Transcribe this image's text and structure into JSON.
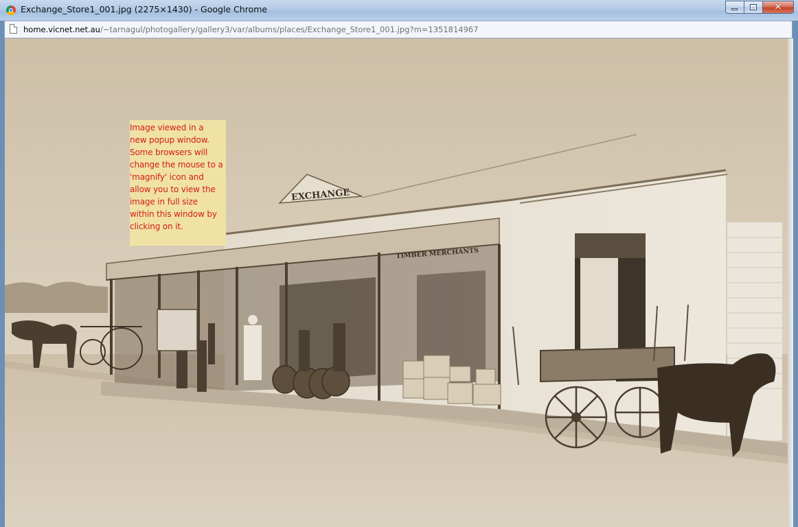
{
  "window": {
    "title": "Exchange_Store1_001.jpg (2275×1430) - Google Chrome"
  },
  "address_bar": {
    "url_host": "home.vicnet.net.au",
    "url_path": "/~tarnagul/photogallery/gallery3/var/albums/places/Exchange_Store1_001.jpg?m=1351814967"
  },
  "photo": {
    "signs": {
      "exchange": "EXCHANGE",
      "timber_merchants": "TIMBER MERCHANTS"
    }
  },
  "note": {
    "lines": [
      "Image viewed in a",
      "new popup window.",
      "Some browsers will",
      "change the mouse to a",
      "'magnify' icon and",
      "allow you to view the",
      "image in full size",
      "within this window by",
      "clicking on it."
    ]
  },
  "icons": {
    "app": "chrome-logo-icon",
    "page": "page-icon",
    "minimize": "minimize-icon",
    "maximize": "maximize-icon",
    "close": "close-icon"
  },
  "colors": {
    "note_background": "#f0e2a4",
    "note_text": "#d31b1b",
    "photo_sepia": "#d8cdb8"
  }
}
